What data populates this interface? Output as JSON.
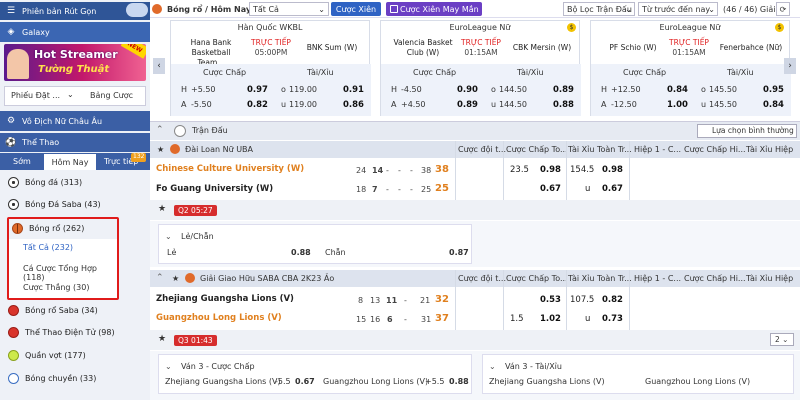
{
  "sidebar": {
    "cashout_label": "Phiên bản Rút Gọn",
    "galaxy_label": "Galaxy",
    "new_badge": "NEW",
    "banner_line1": "Hot Streamer",
    "banner_line2": "Tường Thuật",
    "tab_bet_slip": "Phiếu Đặt ...",
    "tab_bet_list": "Bảng Cược",
    "promo_label": "Vô Địch Nữ Châu Âu",
    "sports_label": "Thể Thao",
    "time_tabs": [
      "Sớm",
      "Hôm Nay",
      "Trực tiếp"
    ],
    "live_badge": "132",
    "items": [
      {
        "label": "Bóng đá",
        "count": "(313)",
        "icon": "soccer-ball-icon"
      },
      {
        "label": "Bóng Đá Saba",
        "count": "(43)",
        "icon": "soccer-ball-icon"
      },
      {
        "label": "Bóng rổ",
        "count": "(262)",
        "icon": "basketball-icon"
      },
      {
        "label": "Bóng rổ Saba",
        "count": "(34)",
        "icon": "basketball-icon"
      },
      {
        "label": "Thể Thao Điện Tử",
        "count": "(98)",
        "icon": "esports-icon"
      },
      {
        "label": "Quần vợt",
        "count": "(177)",
        "icon": "tennis-ball-icon"
      },
      {
        "label": "Bóng chuyền",
        "count": "(33)",
        "icon": "volleyball-icon"
      }
    ],
    "sub_items": [
      {
        "label": "Tất Cả",
        "count": "(232)"
      },
      {
        "label": "Cá Cược Tổng Hợp",
        "count": "(118)"
      },
      {
        "label": "Cược Thắng",
        "count": "(30)"
      }
    ]
  },
  "topbar": {
    "breadcrumb": "Bóng rổ / Hôm Nay",
    "filter_all": "Tất Cả",
    "parlay": "Cược Xiên",
    "lucky_parlay": "Cược Xiên May Mắn",
    "league_filter": "Bộ Lọc Trận Đấu",
    "order": "Từ trước đến nay",
    "pager": "(46 / 46) Giải"
  },
  "cards": [
    {
      "league": "Hàn Quốc WKBL",
      "home": "Hana Bank Basketball Team...",
      "away": "BNK Sum (W)",
      "status": "TRỰC TIẾP",
      "time": "05:00PM",
      "hdr_handicap": "Cược Chấp",
      "hdr_ou": "Tài/Xỉu",
      "rows": [
        {
          "h_lbl": "H",
          "h_line": "+5.50",
          "h_odd": "0.97",
          "ou_lbl": "o",
          "ou_line": "119.00",
          "ou_odd": "0.91"
        },
        {
          "h_lbl": "A",
          "h_line": "-5.50",
          "h_odd": "0.82",
          "ou_lbl": "u",
          "ou_line": "119.00",
          "ou_odd": "0.86"
        }
      ]
    },
    {
      "league": "EuroLeague Nữ",
      "home": "Valencia Basket Club (W)",
      "away": "CBK Mersin (W)",
      "status": "TRỰC TIẾP",
      "time": "01:15AM",
      "hdr_handicap": "Cược Chấp",
      "hdr_ou": "Tài/Xỉu",
      "rows": [
        {
          "h_lbl": "H",
          "h_line": "-4.50",
          "h_odd": "0.90",
          "ou_lbl": "o",
          "ou_line": "144.50",
          "ou_odd": "0.89"
        },
        {
          "h_lbl": "A",
          "h_line": "+4.50",
          "h_odd": "0.89",
          "ou_lbl": "u",
          "ou_line": "144.50",
          "ou_odd": "0.88"
        }
      ]
    },
    {
      "league": "EuroLeague Nữ",
      "home": "PF Schio (W)",
      "away": "Fenerbahce (Nữ)",
      "status": "TRỰC TIẾP",
      "time": "01:15AM",
      "hdr_handicap": "Cược Chấp",
      "hdr_ou": "Tài/Xỉu",
      "rows": [
        {
          "h_lbl": "H",
          "h_line": "+12.50",
          "h_odd": "0.84",
          "ou_lbl": "o",
          "ou_line": "145.50",
          "ou_odd": "0.95"
        },
        {
          "h_lbl": "A",
          "h_line": "-12.50",
          "h_odd": "1.00",
          "ou_lbl": "u",
          "ou_line": "145.50",
          "ou_odd": "0.84"
        }
      ]
    }
  ],
  "table": {
    "section_label": "Trận Đấu",
    "odds_select": "Lựa chọn bình thường",
    "league1": {
      "name": "Đài Loan Nữ UBA",
      "cols": [
        "Cược đội t...",
        "Cược Chấp To...",
        "Tài Xỉu Toàn Tr...",
        "Hiệp 1 - C...",
        "Cược Chấp Hi...",
        "Tài Xỉu Hiệp"
      ],
      "home": {
        "name": "Chinese Culture University (W)",
        "q": [
          "24",
          "14",
          "-",
          "-",
          "-",
          "38"
        ],
        "total": "38"
      },
      "away": {
        "name": "Fo Guang University (W)",
        "q": [
          "18",
          "7",
          "-",
          "-",
          "-",
          "25"
        ],
        "total": "25"
      },
      "odds": {
        "hc_line": "23.5",
        "hc_home": "0.98",
        "hc_away": "0.67",
        "ou_line": "154.5",
        "ou_over": "0.98",
        "ou_lbl": "u",
        "ou_under": "0.67"
      },
      "quarter": "Q2 05:27",
      "sub_title": "Lẻ/Chẵn",
      "odd_lbl": "Lẻ",
      "odd_val": "0.88",
      "even_lbl": "Chẵn",
      "even_val": "0.87"
    },
    "league2": {
      "name": "Giải Giao Hữu SABA CBA 2K23 Ảo",
      "cols": [
        "Cược đội t...",
        "Cược Chấp To...",
        "Tài Xỉu Toàn Tr...",
        "Hiệp 1 - C...",
        "Cược Chấp Hi...",
        "Tài Xỉu Hiệp"
      ],
      "home": {
        "name": "Zhejiang Guangsha Lions (V)",
        "q": [
          "8",
          "13",
          "11",
          "-",
          "21"
        ],
        "total": "32"
      },
      "away": {
        "name": "Guangzhou Long Lions (V)",
        "q": [
          "15",
          "16",
          "6",
          "-",
          "31"
        ],
        "total": "37"
      },
      "odds": {
        "hc_home": "0.53",
        "hc_line_a": "1.5",
        "hc_away": "1.02",
        "ou_line": "107.5",
        "ou_over": "0.82",
        "ou_lbl": "u",
        "ou_under": "0.73"
      },
      "quarter": "Q3 01:43",
      "page_select": "2",
      "sub_left_title": "Ván 3 - Cược Chấp",
      "sub_right_title": "Ván 3 - Tài/Xỉu",
      "sub_left_row": {
        "home": "Zhejiang Guangsha Lions (V)",
        "home_line": "-5.5",
        "home_odd": "0.67",
        "away": "Guangzhou Long Lions (V)",
        "away_line": "+5.5",
        "away_odd": "0.88"
      },
      "sub_right_row": {
        "home": "Zhejiang Guangsha Lions (V)",
        "away": "Guangzhou Long Lions (V)"
      }
    }
  },
  "colors": {
    "brand_blue": "#3b5fa5",
    "live_red": "#e02020",
    "score_orange": "#e0801f",
    "highlight_red": "#e01b1b",
    "parlay_purple": "#6b3fc4"
  }
}
